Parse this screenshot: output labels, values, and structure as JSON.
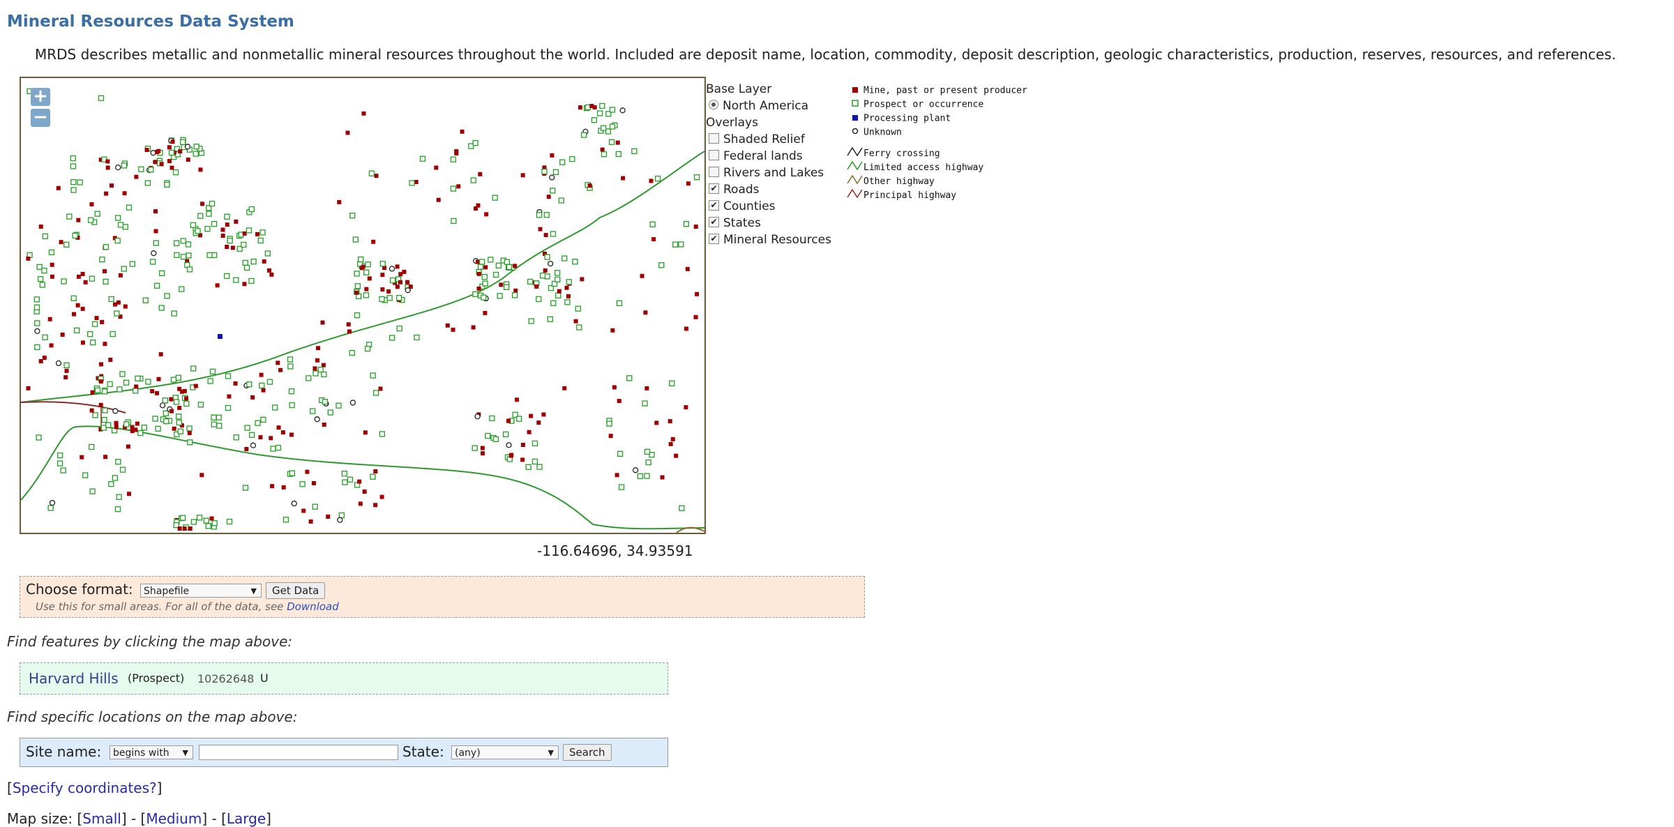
{
  "page": {
    "title": "Mineral Resources Data System",
    "description": "MRDS describes metallic and nonmetallic mineral resources throughout the world. Included are deposit name, location, commodity, deposit description, geologic characteristics, production, reserves, resources, and references."
  },
  "map": {
    "zoom_in": "+",
    "zoom_out": "−",
    "cursor_coords": "-116.64696, 34.93591"
  },
  "layers": {
    "base_heading": "Base Layer",
    "base_layer": "North America",
    "overlays_heading": "Overlays",
    "overlays": [
      {
        "label": "Shaded Relief",
        "checked": false
      },
      {
        "label": "Federal lands",
        "checked": false
      },
      {
        "label": "Rivers and Lakes",
        "checked": false
      },
      {
        "label": "Roads",
        "checked": true
      },
      {
        "label": "Counties",
        "checked": true
      },
      {
        "label": "States",
        "checked": true
      },
      {
        "label": "Mineral Resources",
        "checked": true
      }
    ]
  },
  "legend": {
    "items": [
      {
        "label": "Mine, past or present producer",
        "color": "#a00000"
      },
      {
        "label": "Prospect or occurrence",
        "color": "#22a022"
      },
      {
        "label": "Processing plant",
        "color": "#1010b0"
      },
      {
        "label": "Unknown",
        "color": "#222222"
      }
    ],
    "roads": [
      {
        "label": "Ferry crossing",
        "color": "#222222"
      },
      {
        "label": "Limited access highway",
        "color": "#22a022"
      },
      {
        "label": "Other highway",
        "color": "#8b6a2a"
      },
      {
        "label": "Principal highway",
        "color": "#8b2a2a"
      }
    ]
  },
  "format": {
    "label": "Choose format:",
    "selected": "Shapefile",
    "button": "Get Data",
    "hint": "Use this for small areas. For all of the data, see",
    "hint_link": "Download"
  },
  "find_click": {
    "heading": "Find features by clicking the map above:",
    "result_name": "Harvard Hills",
    "result_type": "(Prospect)",
    "result_id": "10262648",
    "result_code": "U"
  },
  "find_location": {
    "heading": "Find specific locations on the map above:",
    "site_label": "Site name:",
    "match_mode": "begins with",
    "site_value": "",
    "state_label": "State:",
    "state_selected": "(any)",
    "search_button": "Search"
  },
  "links": {
    "specify_open": "[",
    "specify": "Specify coordinates?",
    "specify_close": "]",
    "map_size_label": "Map size:",
    "small": "Small",
    "medium": "Medium",
    "large": "Large"
  }
}
